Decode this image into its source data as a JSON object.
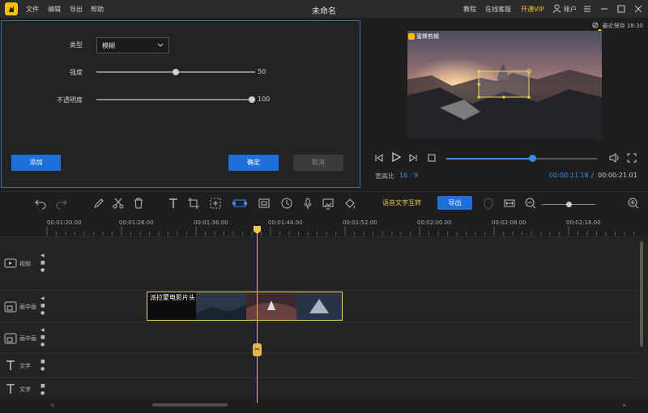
{
  "titlebar": {
    "menu": [
      "文件",
      "编辑",
      "导出",
      "帮助"
    ],
    "title": "未命名",
    "links": [
      "教程",
      "在线客服",
      "开通VIP",
      "账户"
    ]
  },
  "effect_panel": {
    "type_label": "类型",
    "type_value": "模糊",
    "strength_label": "强度",
    "strength_value": "50",
    "opacity_label": "不透明度",
    "opacity_value": "100",
    "add_button": "添加",
    "confirm_button": "确定",
    "cancel_button": "取消"
  },
  "preview": {
    "autosave": "最近保存 18:30",
    "watermark": "蜜蜂剪辑",
    "ratio_label": "宽高比",
    "ratio_value": "16 : 9",
    "current_time": "00:00:11.18",
    "time_separator": "/",
    "total_time": "00:00:21.01",
    "progress": 0.57
  },
  "toolbar": {
    "speech_text": "语音文字互转",
    "export": "导出",
    "zoom": 0.5
  },
  "ruler": {
    "ticks": [
      "00:01:20.00",
      "00:01:28.00",
      "00:01:36.00",
      "00:01:44.00",
      "00:01:52.00",
      "00:02:00.00",
      "00:02:08.00",
      "00:02:16.00"
    ]
  },
  "tracks": {
    "video": "视频",
    "pip1": "画中画",
    "pip2": "画中画",
    "text1": "文字",
    "text2": "文字",
    "clip_label": "派拉蒙电影片头"
  },
  "colors": {
    "accent": "#1e6fd9",
    "vip": "#f5c518",
    "playhead": "#e9b64a",
    "clip_border": "#e6d85a"
  }
}
